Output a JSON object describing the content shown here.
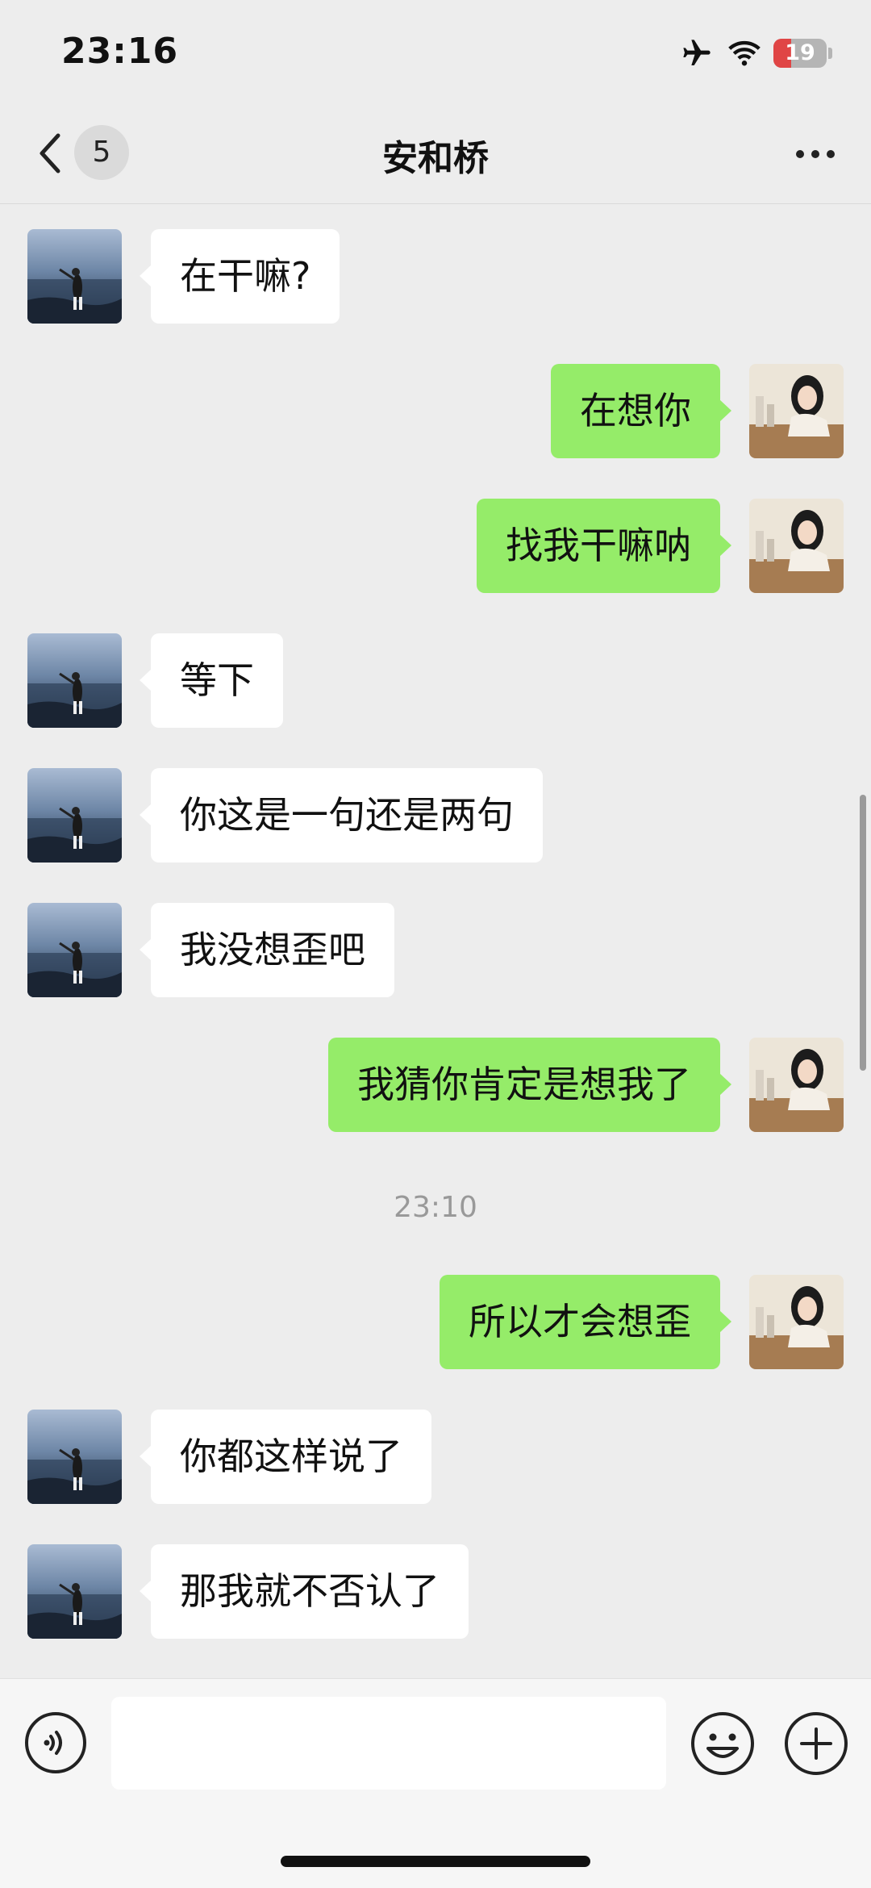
{
  "status_bar": {
    "time": "23:16",
    "battery": "19",
    "battery_level": 0.19,
    "icons": [
      "airplane-icon",
      "wifi-icon",
      "battery-icon"
    ]
  },
  "nav": {
    "back_count": "5",
    "title": "安和桥",
    "more_icon": "more-icon"
  },
  "messages": [
    {
      "side": "left",
      "text": "在干嘛?"
    },
    {
      "side": "right",
      "text": "在想你"
    },
    {
      "side": "right",
      "text": "找我干嘛呐"
    },
    {
      "side": "left",
      "text": "等下"
    },
    {
      "side": "left",
      "text": "你这是一句还是两句"
    },
    {
      "side": "left",
      "text": "我没想歪吧"
    },
    {
      "side": "right",
      "text": "我猜你肯定是想我了"
    },
    {
      "side": "right",
      "text": "所以才会想歪"
    },
    {
      "side": "left",
      "text": "你都这样说了"
    },
    {
      "side": "left",
      "text": "那我就不否认了"
    }
  ],
  "timestamp": "23:10",
  "input": {
    "value": "",
    "placeholder": ""
  },
  "colors": {
    "sent_bubble": "#95ec69",
    "received_bubble": "#ffffff",
    "background": "#ededed"
  }
}
